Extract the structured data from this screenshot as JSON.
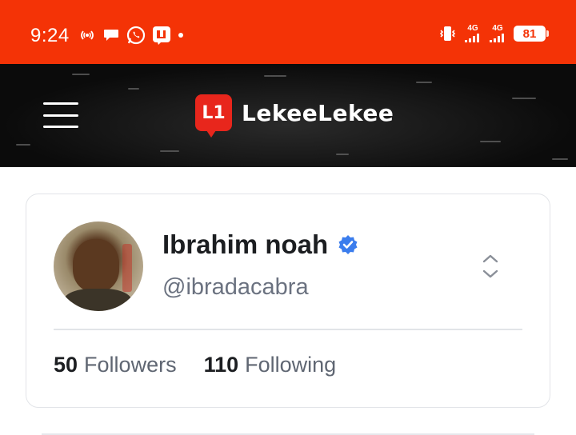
{
  "status_bar": {
    "time": "9:24",
    "left_icons": [
      "radio-waves-icon",
      "chat-bubble-icon",
      "whatsapp-icon",
      "lekee-app-icon",
      "dot-icon"
    ],
    "network_1": "4G",
    "network_2": "4G",
    "battery": "81",
    "bg_color": "#f43306"
  },
  "header": {
    "logo_text": "L1",
    "brand_name": "LekeeLekee",
    "logo_color": "#e8261c"
  },
  "profile": {
    "display_name": "Ibrahim noah",
    "handle": "@ibradacabra",
    "verified": true,
    "verified_color": "#3b7ded",
    "followers_count": "50",
    "followers_label": "Followers",
    "following_count": "110",
    "following_label": "Following"
  }
}
